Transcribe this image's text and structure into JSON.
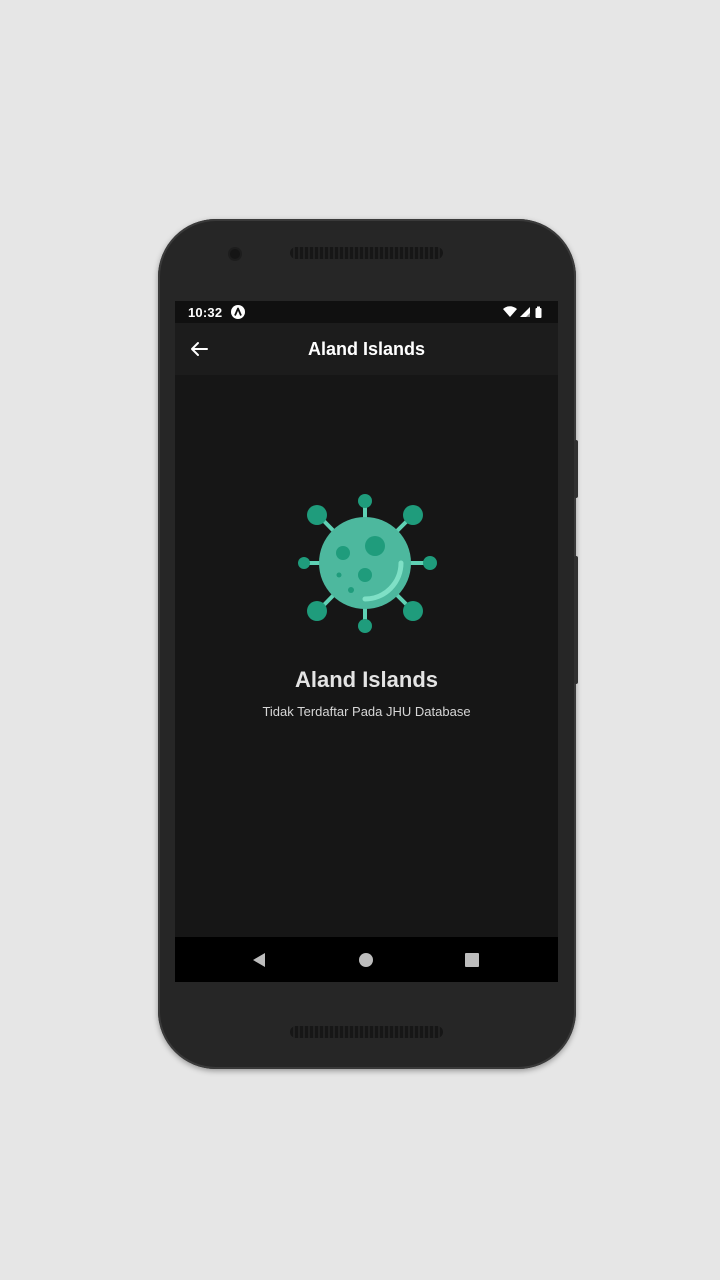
{
  "status_bar": {
    "time": "10:32",
    "icons": [
      "app-notification-icon",
      "wifi-icon",
      "signal-icon",
      "battery-icon"
    ]
  },
  "app_bar": {
    "title": "Aland Islands",
    "back_icon": "arrow-back-icon"
  },
  "content": {
    "icon": "virus-icon",
    "country_name": "Aland Islands",
    "status_text": "Tidak Terdaftar Pada JHU Database"
  },
  "nav_bar": {
    "buttons": [
      "back-triangle-icon",
      "home-circle-icon",
      "recents-square-icon"
    ]
  },
  "colors": {
    "background": "#161616",
    "app_bar": "#1c1c1c",
    "virus_body": "#4db89e",
    "virus_accent": "#1f9c7c",
    "virus_highlight": "#7fe0c6"
  }
}
